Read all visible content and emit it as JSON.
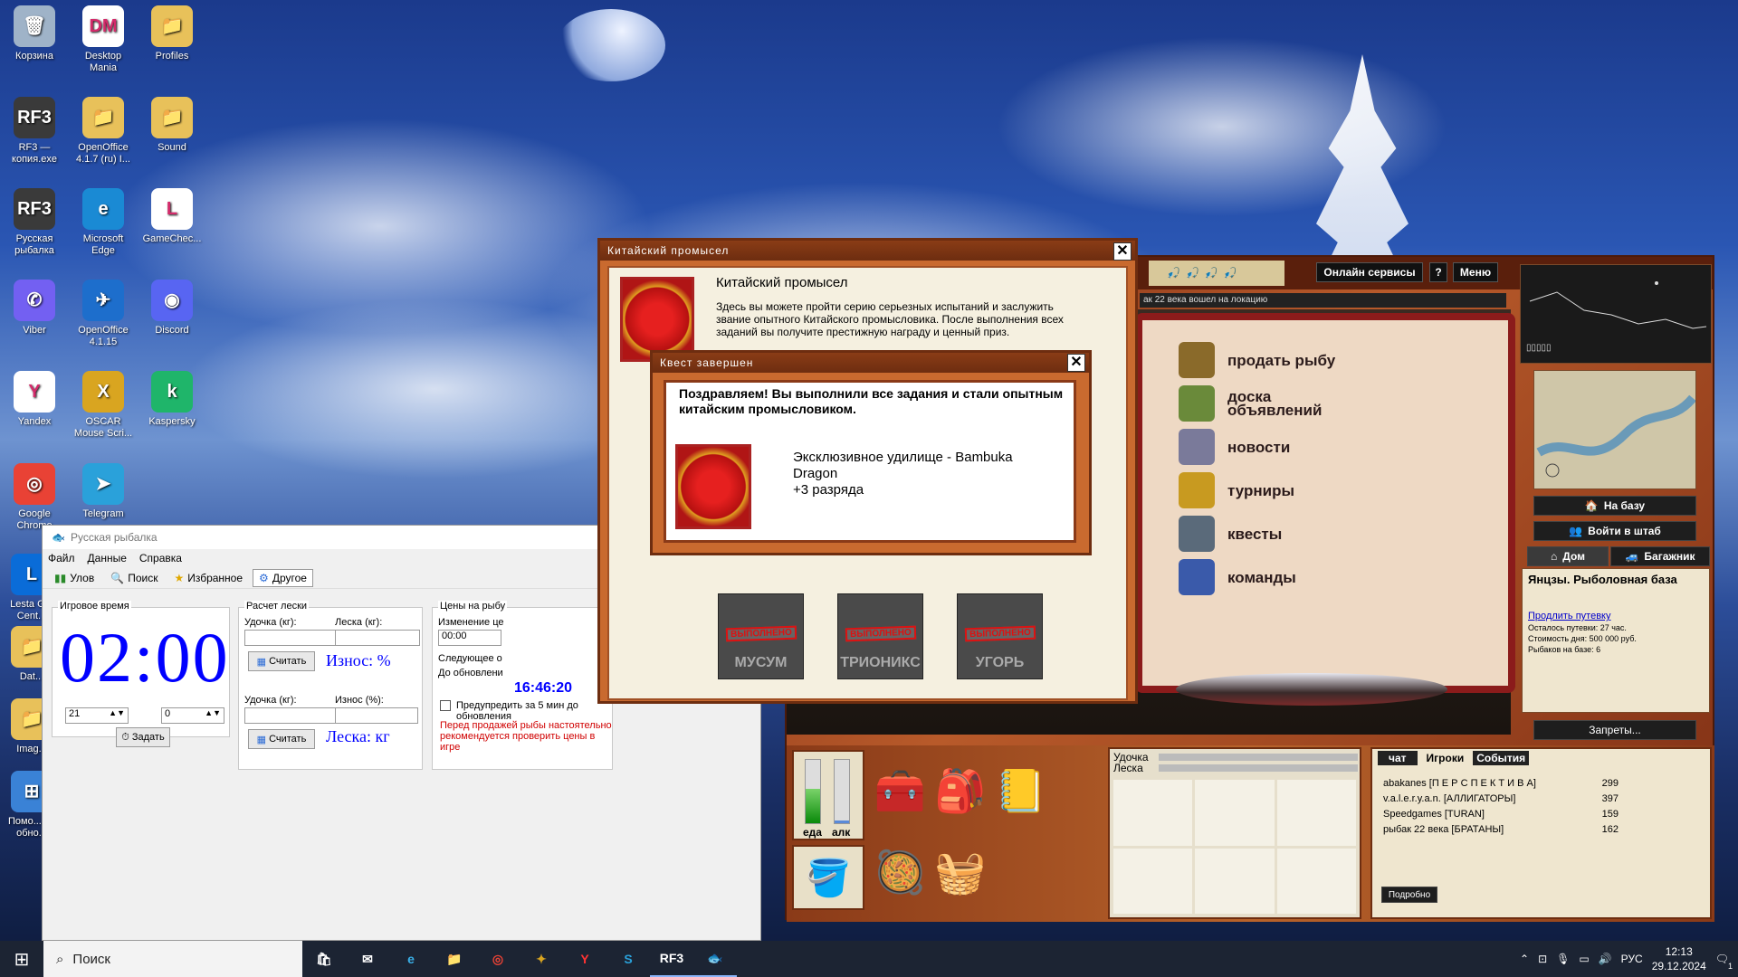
{
  "desktop_icons": [
    {
      "label": "Корзина",
      "icon": "recycle-bin-icon",
      "color": "#9fb3c8",
      "glyph": "🗑"
    },
    {
      "label": "Desktop Mania",
      "icon": "desktop-mania-icon",
      "color": "#ffffff",
      "glyph": "DM"
    },
    {
      "label": "Profiles",
      "icon": "folder-icon",
      "color": "#e8c15a",
      "glyph": "📁"
    },
    {
      "label": "RF3 — копия.exe",
      "icon": "rf3-icon",
      "color": "#3a3a3a",
      "glyph": "RF3"
    },
    {
      "label": "OpenOffice 4.1.7 (ru) I...",
      "icon": "folder-icon",
      "color": "#e8c15a",
      "glyph": "📁"
    },
    {
      "label": "Sound",
      "icon": "folder-icon",
      "color": "#e8c15a",
      "glyph": "📁"
    },
    {
      "label": "Русская рыбалка",
      "icon": "rf3-icon",
      "color": "#3a3a3a",
      "glyph": "RF3"
    },
    {
      "label": "Microsoft Edge",
      "icon": "edge-icon",
      "color": "#1a8ad4",
      "glyph": "e"
    },
    {
      "label": "GameChec...",
      "icon": "gamecheck-icon",
      "color": "#ffffff",
      "glyph": "L"
    },
    {
      "label": "Viber",
      "icon": "viber-icon",
      "color": "#7360f2",
      "glyph": "✆"
    },
    {
      "label": "OpenOffice 4.1.15",
      "icon": "openoffice-icon",
      "color": "#1d6ecc",
      "glyph": "✈"
    },
    {
      "label": "Discord",
      "icon": "discord-icon",
      "color": "#5865f2",
      "glyph": "◉"
    },
    {
      "label": "Yandex",
      "icon": "yandex-icon",
      "color": "#ffffff",
      "glyph": "Y"
    },
    {
      "label": "OSCAR Mouse Scri...",
      "icon": "oscar-icon",
      "color": "#d9a520",
      "glyph": "X"
    },
    {
      "label": "Kaspersky",
      "icon": "kaspersky-icon",
      "color": "#1fb56a",
      "glyph": "k"
    },
    {
      "label": "Google Chrome",
      "icon": "chrome-icon",
      "color": "#e94235",
      "glyph": "◎"
    },
    {
      "label": "Telegram",
      "icon": "telegram-icon",
      "color": "#2aa1da",
      "glyph": "➤"
    },
    {
      "label": "Lesta G... Cent...",
      "icon": "lesta-icon",
      "color": "#0a6cd8",
      "glyph": "L"
    },
    {
      "label": "Dat...",
      "icon": "folder-icon",
      "color": "#e8c15a",
      "glyph": "📁"
    },
    {
      "label": "Imag...",
      "icon": "folder-icon",
      "color": "#e8c15a",
      "glyph": "📁"
    },
    {
      "label": "Помо... по обно...",
      "icon": "help-icon",
      "color": "#3a82d6",
      "glyph": "⊞"
    }
  ],
  "taskbar": {
    "search_placeholder": "Поиск",
    "lang": "РУС",
    "time": "12:13",
    "date": "29.12.2024",
    "notif_count": "1",
    "rf3_label": "RF3"
  },
  "winapp": {
    "title": "Русская рыбалка",
    "menu": [
      "Файл",
      "Данные",
      "Справка"
    ],
    "toolbar": [
      "Улов",
      "Поиск",
      "Избранное",
      "Другое"
    ],
    "game_time_group": "Игровое время",
    "clock": "02:00",
    "hours_value": "21",
    "minutes_value": "0",
    "set_button": "Задать",
    "line_group": "Расчет лески",
    "rod_kg_label": "Удочка (кг):",
    "line_kg_label": "Леска (кг):",
    "calc_button": "Считать",
    "wear_label": "Износ: %",
    "rod_kg_label2": "Удочка (кг):",
    "wear_pct_label": "Износ (%):",
    "calc_button2": "Считать",
    "line_result": "Леска:  кг",
    "prices_group": "Цены на рыбу",
    "change_label": "Изменение це",
    "change_value": "00:00",
    "next_label": "Следующее о",
    "until_label": "До обновлени",
    "update_time": "16:46:20",
    "warn_checkbox": "Предупредить за 5 мин до обновления",
    "warning_text": "Перед продажей рыбы настоятельно рекомендуется проверить цены в игре"
  },
  "game": {
    "online_services": "Онлайн сервисы",
    "help": "?",
    "menu": "Меню",
    "status_line": "ак 22 века вошел на локацию",
    "book_items": [
      {
        "label": "продать рыбу",
        "icon": "sell-fish-icon"
      },
      {
        "label": "доска объявлений",
        "icon": "board-icon"
      },
      {
        "label": "новости",
        "icon": "news-icon"
      },
      {
        "label": "турниры",
        "icon": "trophy-icon"
      },
      {
        "label": "квесты",
        "icon": "quests-icon"
      },
      {
        "label": "команды",
        "icon": "teams-icon"
      }
    ],
    "to_base": "На базу",
    "enter_hq": "Войти в штаб",
    "home_tab": "Дом",
    "trunk_tab": "Багажник",
    "location_title": "Янцзы. Рыболовная база",
    "extend_link": "Продлить путевку",
    "remaining": "Осталось путевки: 27 час.",
    "cost": "Стоимость дня: 500 000 руб.",
    "fishers": "Рыбаков на базе: 6",
    "bans": "Запреты...",
    "rod_label": "Удочка",
    "line_label": "Леска",
    "food_label": "еда",
    "alc_label": "алк",
    "food_level": 0.55,
    "alc_level": 0.05,
    "chat_tabs": [
      "чат",
      "Игроки",
      "События"
    ],
    "players": [
      {
        "name": "abakanes [П Е Р С П Е К Т И В А]",
        "score": "299"
      },
      {
        "name": "v.a.l.e.r.y.a.n. [АЛЛИГАТОРЫ]",
        "score": "397"
      },
      {
        "name": "Speedgames [TURAN]",
        "score": "159"
      },
      {
        "name": "рыбак 22 века [БРАТАНЫ]",
        "score": "162"
      }
    ],
    "details_button": "Подробно",
    "depth_label": "▯▯▯▯▯"
  },
  "quest_dialog": {
    "title": "Китайский промысел",
    "heading": "Китайский промысел",
    "description": "Здесь вы можете пройти серию серьезных испытаний и заслужить звание опытного Китайского промысловика. После выполнения всех заданий вы получите престижную награду и ценный приз.",
    "fish": [
      {
        "name": "МУСУМ",
        "stamp": "ВЫПОЛНЕНО"
      },
      {
        "name": "ТРИОНИКС",
        "stamp": "ВЫПОЛНЕНО"
      },
      {
        "name": "УГОРЬ",
        "stamp": "ВЫПОЛНЕНО"
      }
    ]
  },
  "complete_dialog": {
    "title": "Квест завершен",
    "congrats": "Поздравляем! Вы выполнили все задания и стали опытным китайским промысловиком.",
    "reward_line1": "Эксклюзивное удилище - Bambuka Dragon",
    "reward_line2": "+3 разряда"
  },
  "colors": {
    "accent_blue": "#0000ff",
    "warning_red": "#d00000",
    "dialog_brown": "#c96a2f",
    "game_dark": "#1e1e1e"
  }
}
